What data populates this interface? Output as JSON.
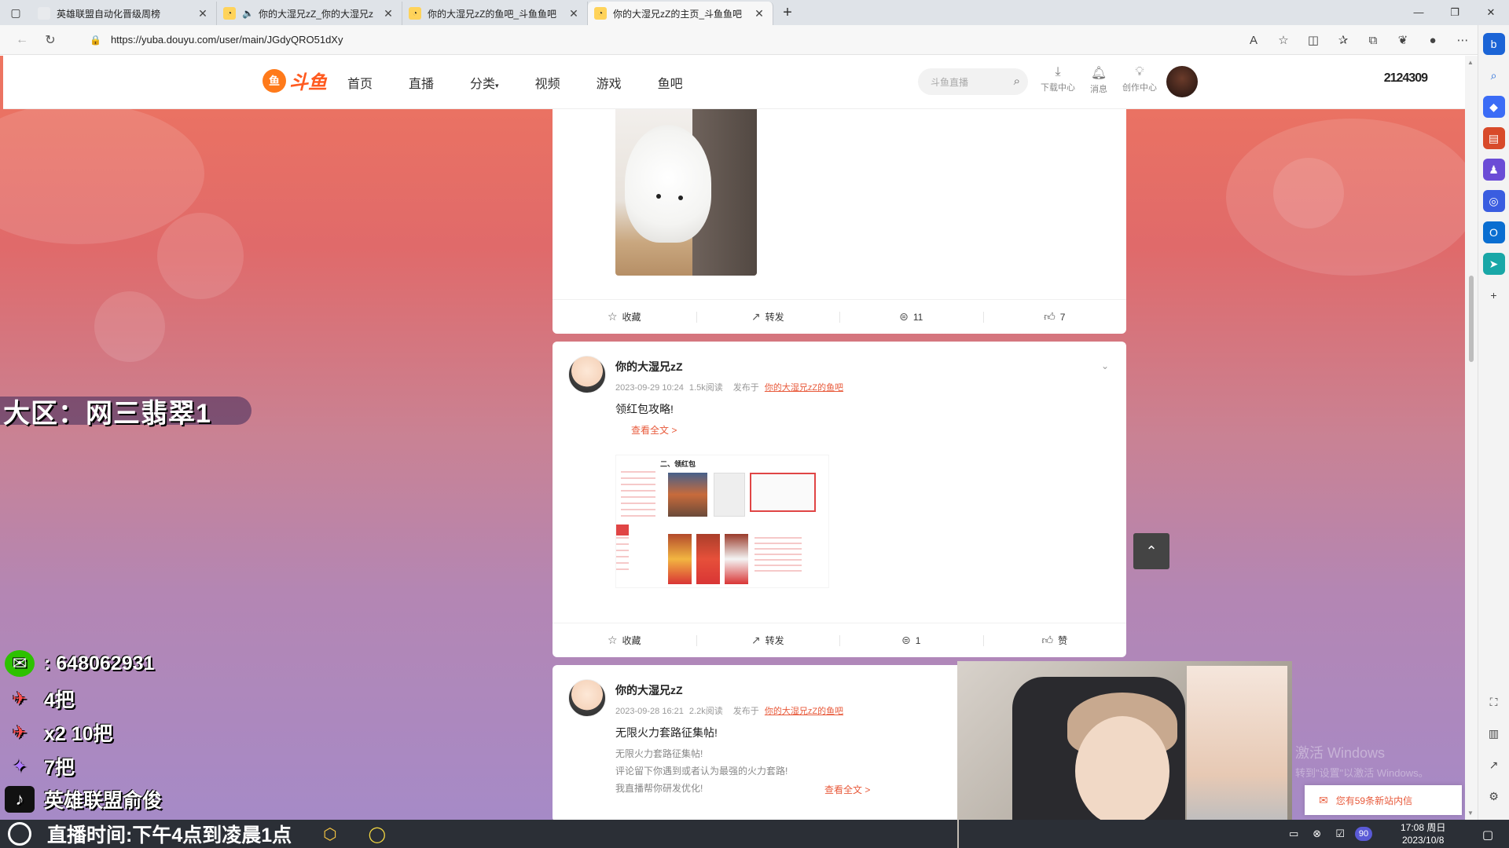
{
  "browser": {
    "tabs": [
      {
        "title": "英雄联盟自动化晋级周榜",
        "active": false,
        "audio": false
      },
      {
        "title": "你的大湿兄zZ_你的大湿兄z",
        "active": false,
        "audio": true
      },
      {
        "title": "你的大湿兄zZ的鱼吧_斗鱼鱼吧",
        "active": false,
        "audio": false
      },
      {
        "title": "你的大湿兄zZ的主页_斗鱼鱼吧",
        "active": true,
        "audio": false
      }
    ],
    "url": "https://yuba.douyu.com/user/main/JGdyQRO51dXy"
  },
  "site": {
    "logo_text": "斗鱼",
    "nav": [
      "首页",
      "直播",
      "分类",
      "视频",
      "游戏",
      "鱼吧"
    ],
    "search_placeholder": "斗鱼直播",
    "header_icons": [
      {
        "icon": "download-icon",
        "label": "下载中心"
      },
      {
        "icon": "bell-icon",
        "label": "消息"
      },
      {
        "icon": "lightbulb-icon",
        "label": "创作中心"
      }
    ],
    "viewer_count": "2124309"
  },
  "posts": [
    {
      "actions": {
        "favorite": "收藏",
        "share": "转发",
        "comments": "11",
        "likes": "7"
      }
    },
    {
      "author": "你的大湿兄zZ",
      "date": "2023-09-29 10:24",
      "reads": "1.5k阅读",
      "published_in_label": "发布于",
      "bar_name": "你的大湿兄zZ的鱼吧",
      "title": "领红包攻略!",
      "read_more": "查看全文 >",
      "image_heading": "二、领红包",
      "actions": {
        "favorite": "收藏",
        "share": "转发",
        "comments": "1",
        "likes": "赞"
      }
    },
    {
      "author": "你的大湿兄zZ",
      "date": "2023-09-28 16:21",
      "reads": "2.2k阅读",
      "published_in_label": "发布于",
      "bar_name": "你的大湿兄zZ的鱼吧",
      "title": "无限火力套路征集帖!",
      "lines": [
        "无限火力套路征集帖!",
        "评论留下你遇到或者认为最强的火力套路!",
        "我直播帮你研发优化!"
      ],
      "read_more": "查看全文 >"
    }
  ],
  "overlay": {
    "region": "大区：网三翡翠1",
    "lines": [
      {
        "icon": "wechat-icon",
        "text": ": 648062931"
      },
      {
        "icon": "plane-icon",
        "text": "4把"
      },
      {
        "icon": "plane-icon",
        "text": "x2 10把"
      },
      {
        "icon": "rocket-icon",
        "text": "7把"
      },
      {
        "icon": "tiktok-icon",
        "text": "英雄联盟俞俊"
      }
    ],
    "schedule": "直播时间:下午4点到凌晨1点"
  },
  "messages_banner": "您有59条新站内信",
  "watermark": {
    "line1": "激活 Windows",
    "line2": "转到\"设置\"以激活 Windows。"
  },
  "taskbar": {
    "badge": "90",
    "time": "17:08 周日",
    "date": "2023/10/8"
  }
}
